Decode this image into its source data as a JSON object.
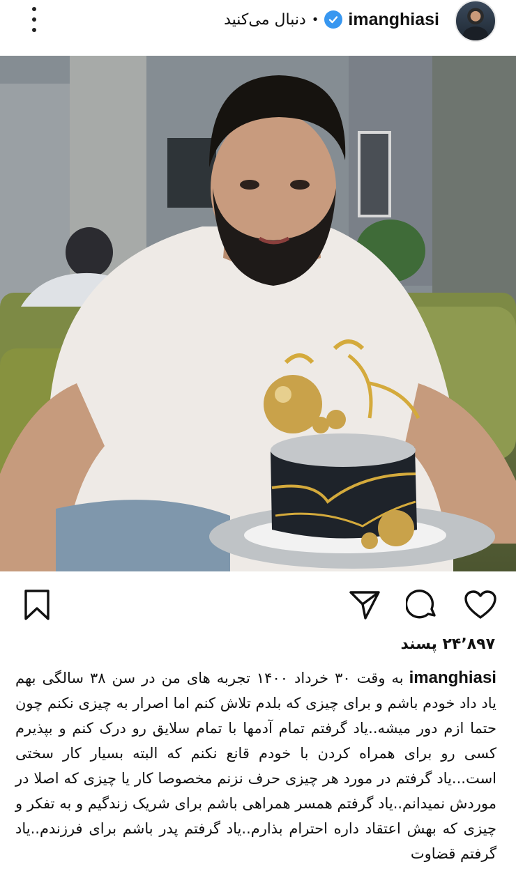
{
  "header": {
    "username": "imanghiasi",
    "follow_status": "دنبال می‌کنید",
    "separator": "•"
  },
  "post": {
    "likes": "۲۴٬۸۹۷ پسند",
    "caption_user": "imanghiasi",
    "caption_text": "به وقت ۳۰ خرداد ۱۴۰۰ تجربه های من در سن ۳۸ سالگی بهم یاد داد خودم باشم و برای چیزی که بلدم تلاش کنم اما اصرار به چیزی نکنم چون حتما ازم دور میشه..یاد گرفتم تمام آدمها با تمام سلایق رو درک کنم و بپذیرم کسی رو برای همراه کردن با خودم قانع نکنم که البته بسیار کار سختی است...یاد گرفتم در مورد هر چیزی حرف نزنم مخصوصا کار یا چیزی که اصلا در موردش نمیدانم..یاد گرفتم همسر همراهی باشم برای شریک زندگیم و به تفکر و چیزی که بهش اعتقاد داره احترام بذارم..یاد گرفتم پدر باشم برای فرزندم..یاد گرفتم قضاوت"
  },
  "icons": {
    "more": "more-vertical-icon",
    "verified": "verified-badge-icon",
    "like": "heart-icon",
    "comment": "comment-icon",
    "share": "send-icon",
    "save": "bookmark-icon"
  },
  "colors": {
    "verified": "#3897f0",
    "text": "#111111"
  }
}
